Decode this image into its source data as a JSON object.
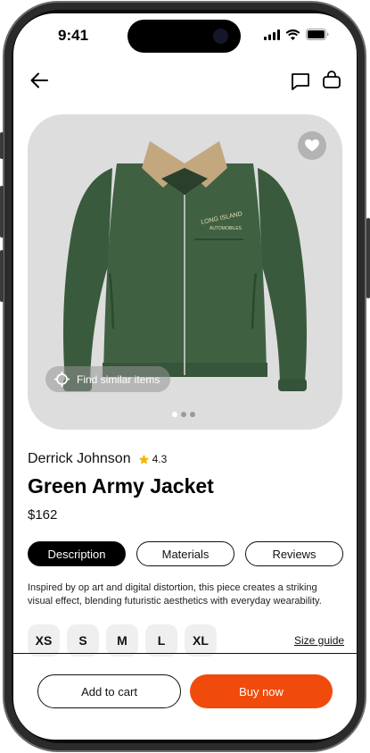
{
  "status_bar": {
    "time": "9:41",
    "icons": [
      "signal-icon",
      "wifi-icon",
      "battery-icon"
    ]
  },
  "nav": {
    "back_icon": "arrow-left-icon",
    "chat_icon": "chat-icon",
    "bag_icon": "shopping-bag-icon"
  },
  "product": {
    "image_icon": "jacket-image",
    "favorite_icon": "heart-icon",
    "find_similar_label": "Find similar items",
    "carousel_active_index": 0,
    "carousel_count": 3,
    "seller": "Derrick Johnson",
    "rating": "4.3",
    "title": "Green Army Jacket",
    "price": "$162",
    "jacket_patch_line1": "LONG ISLAND",
    "jacket_patch_line2": "AUTOMOBILES"
  },
  "tabs": [
    {
      "label": "Description",
      "active": true
    },
    {
      "label": "Materials",
      "active": false
    },
    {
      "label": "Reviews",
      "active": false
    }
  ],
  "description": "Inspired by op art and digital distortion, this piece creates a striking visual effect, blending futuristic aesthetics with everyday wearability.",
  "sizes": [
    "XS",
    "S",
    "M",
    "L",
    "XL"
  ],
  "size_guide_label": "Size guide",
  "actions": {
    "add_to_cart": "Add to cart",
    "buy_now": "Buy now"
  },
  "colors": {
    "accent": "#f04b0c",
    "jacket_green": "#3d5e40",
    "collar": "#c2a77f",
    "star": "#f5b800"
  }
}
